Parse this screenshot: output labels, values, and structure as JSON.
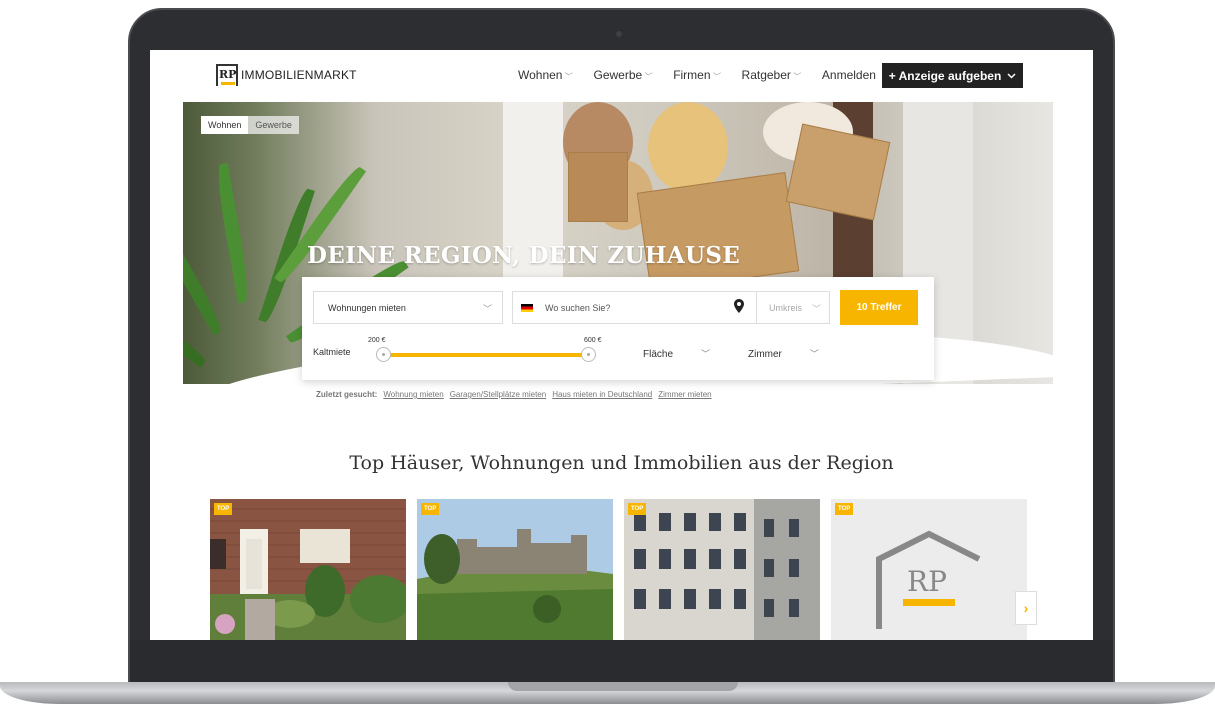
{
  "header": {
    "logo_mark": "RP",
    "logo_text": "IMMOBILIENMARKT",
    "nav": [
      "Wohnen",
      "Gewerbe",
      "Firmen",
      "Ratgeber"
    ],
    "login": "Anmelden",
    "cta": "+ Anzeige aufgeben"
  },
  "hero": {
    "tabs": [
      "Wohnen",
      "Gewerbe"
    ],
    "headline": "DEINE REGION, DEIN ZUHAUSE"
  },
  "search": {
    "property_type": "Wohnungen mieten",
    "location_placeholder": "Wo suchen Sie?",
    "radius": "Umkreis",
    "submit": "10 Treffer",
    "rent_label": "Kaltmiete",
    "rent_min": "200 €",
    "rent_max": "600 €",
    "rent_range_fraction": [
      0.0,
      1.0
    ],
    "area": "Fläche",
    "rooms": "Zimmer"
  },
  "recent": {
    "label": "Zuletzt gesucht:",
    "links": [
      "Wohnung mieten",
      "Garagen/Stellplätze mieten",
      "Haus mieten in Deutschland",
      "Zimmer mieten"
    ]
  },
  "listings": {
    "title": "Top Häuser, Wohnungen und Immobilien aus der Region",
    "badge": "TOP",
    "next_label": "›"
  },
  "colors": {
    "accent": "#f7b500",
    "dark": "#222222"
  }
}
